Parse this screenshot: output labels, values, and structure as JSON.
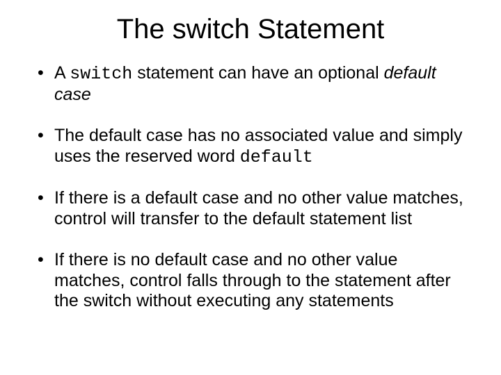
{
  "title": "The switch Statement",
  "bullets": {
    "b1": {
      "t1": "A ",
      "code": "switch",
      "t2": " statement can have an optional ",
      "italic": "default case"
    },
    "b2": {
      "t1": "The default case has no associated value and simply uses the reserved word ",
      "code": "default"
    },
    "b3": {
      "t1": "If there is a default case and no other value matches, control will transfer to the default statement list"
    },
    "b4": {
      "t1": "If there is no default case and no other value matches, control falls through to the statement after the switch without executing any statements"
    }
  }
}
